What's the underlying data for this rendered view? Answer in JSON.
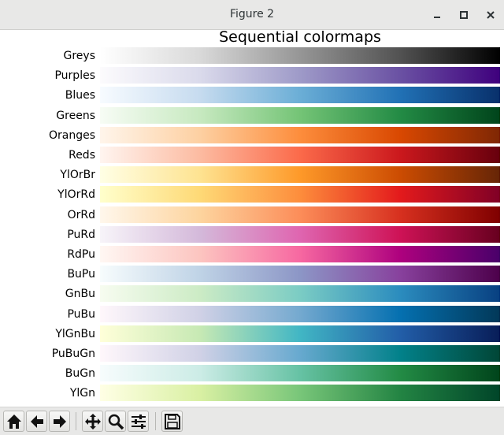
{
  "window": {
    "title": "Figure 2"
  },
  "toolbar": {
    "buttons": [
      {
        "name": "home",
        "icon": "home-icon"
      },
      {
        "name": "back",
        "icon": "arrow-left-icon"
      },
      {
        "name": "forward",
        "icon": "arrow-right-icon"
      },
      {
        "name": "pan",
        "icon": "move-icon"
      },
      {
        "name": "zoom",
        "icon": "magnifier-icon"
      },
      {
        "name": "configure-subplots",
        "icon": "sliders-icon"
      },
      {
        "name": "save",
        "icon": "floppy-disk-icon"
      }
    ]
  },
  "figure": {
    "title": "Sequential colormaps",
    "colormaps": [
      {
        "name": "Greys",
        "colors": [
          "#ffffff",
          "#d9d9d9",
          "#969696",
          "#525252",
          "#000000"
        ]
      },
      {
        "name": "Purples",
        "colors": [
          "#fcfbfd",
          "#dadaeb",
          "#9e9ac8",
          "#6a51a3",
          "#3f007d"
        ]
      },
      {
        "name": "Blues",
        "colors": [
          "#f7fbff",
          "#c6dbef",
          "#6baed6",
          "#2171b5",
          "#08306b"
        ]
      },
      {
        "name": "Greens",
        "colors": [
          "#f7fcf5",
          "#c7e9c0",
          "#74c476",
          "#238b45",
          "#00441b"
        ]
      },
      {
        "name": "Oranges",
        "colors": [
          "#fff5eb",
          "#fdd0a2",
          "#fd8d3c",
          "#d94801",
          "#7f2704"
        ]
      },
      {
        "name": "Reds",
        "colors": [
          "#fff5f0",
          "#fcbba1",
          "#fb6a4a",
          "#cb181d",
          "#67000d"
        ]
      },
      {
        "name": "YlOrBr",
        "colors": [
          "#ffffe5",
          "#fee391",
          "#fe9929",
          "#cc4c02",
          "#662506"
        ]
      },
      {
        "name": "YlOrRd",
        "colors": [
          "#ffffcc",
          "#fed976",
          "#fd8d3c",
          "#e31a1c",
          "#800026"
        ]
      },
      {
        "name": "OrRd",
        "colors": [
          "#fff7ec",
          "#fdd49e",
          "#fc8d59",
          "#d7301f",
          "#7f0000"
        ]
      },
      {
        "name": "PuRd",
        "colors": [
          "#f7f4f9",
          "#d4b9da",
          "#df65b0",
          "#ce1256",
          "#67001f"
        ]
      },
      {
        "name": "RdPu",
        "colors": [
          "#fff7f3",
          "#fcc5c0",
          "#f768a1",
          "#ae017e",
          "#49006a"
        ]
      },
      {
        "name": "BuPu",
        "colors": [
          "#f7fcfd",
          "#bfd3e6",
          "#8c96c6",
          "#88419d",
          "#4d004b"
        ]
      },
      {
        "name": "GnBu",
        "colors": [
          "#f7fcf0",
          "#ccebc5",
          "#7bccc4",
          "#2b8cbe",
          "#084081"
        ]
      },
      {
        "name": "PuBu",
        "colors": [
          "#fff7fb",
          "#d0d1e6",
          "#74a9cf",
          "#0570b0",
          "#023858"
        ]
      },
      {
        "name": "YlGnBu",
        "colors": [
          "#ffffd9",
          "#c7e9b4",
          "#41b6c4",
          "#225ea8",
          "#081d58"
        ]
      },
      {
        "name": "PuBuGn",
        "colors": [
          "#fff7fb",
          "#d0d1e6",
          "#67a9cf",
          "#02818a",
          "#014636"
        ]
      },
      {
        "name": "BuGn",
        "colors": [
          "#f7fcfd",
          "#ccece6",
          "#66c2a4",
          "#238b45",
          "#00441b"
        ]
      },
      {
        "name": "YlGn",
        "colors": [
          "#ffffe5",
          "#d9f0a3",
          "#78c679",
          "#238443",
          "#004529"
        ]
      }
    ]
  }
}
